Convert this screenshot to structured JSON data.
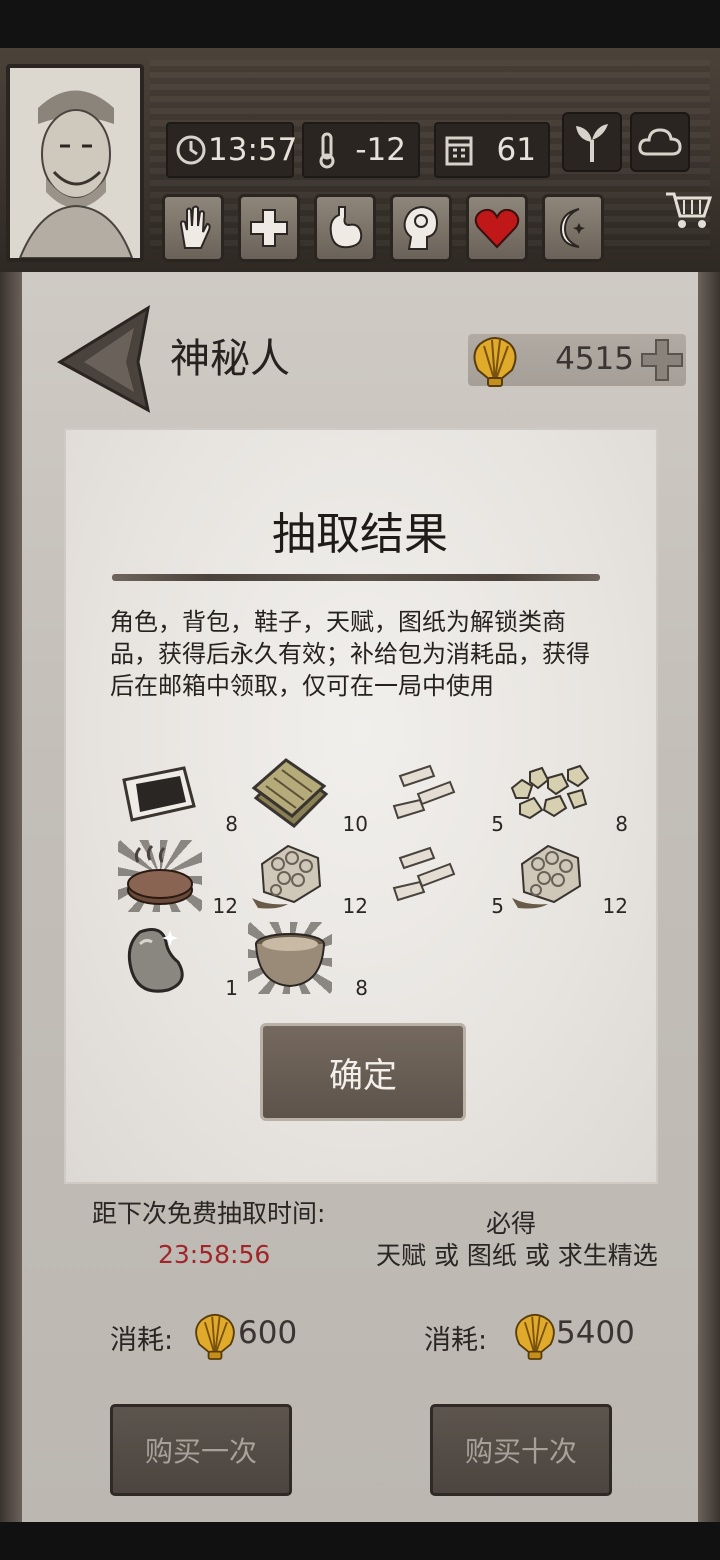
{
  "hud": {
    "time": "13:57",
    "temperature": "-12",
    "day": "61",
    "icons": {
      "clock": "clock-icon",
      "thermometer": "thermometer-icon",
      "calendar": "calendar-icon",
      "sprout": "sprout-icon",
      "weather": "cloud-icon",
      "cart": "shopping-cart-icon"
    },
    "status_icons": [
      "hand-icon",
      "medical-cross-icon",
      "stomach-icon",
      "head-icon",
      "heart-icon",
      "moon-icon"
    ]
  },
  "page": {
    "title": "神秘人",
    "currency_amount": "4515"
  },
  "modal": {
    "title": "抽取结果",
    "description": "角色，背包，鞋子，天赋，图纸为解锁类商品，获得后永久有效；补给包为消耗品，获得后在邮箱中领取，仅可在一局中使用",
    "items": [
      {
        "icon": "cloth-patch-icon",
        "count": "8"
      },
      {
        "icon": "wooden-boards-icon",
        "count": "10"
      },
      {
        "icon": "sticks-icon",
        "count": "5"
      },
      {
        "icon": "ore-nuggets-icon",
        "count": "8"
      },
      {
        "icon": "grilled-meat-icon",
        "count": "12"
      },
      {
        "icon": "honeycomb-icon",
        "count": "12"
      },
      {
        "icon": "sticks-icon",
        "count": "5"
      },
      {
        "icon": "honeycomb-icon",
        "count": "12"
      },
      {
        "icon": "bean-icon",
        "count": "1"
      },
      {
        "icon": "soup-bowl-icon",
        "count": "8"
      }
    ],
    "confirm_label": "确定"
  },
  "draw": {
    "timer_label": "距下次免费抽取时间:",
    "timer_value": "23:58:56",
    "guarantee_title": "必得",
    "guarantee_text": "天赋 或 图纸 或 求生精选",
    "cost_label": "消耗:",
    "cost_single": "600",
    "cost_ten": "5400",
    "buy_once_label": "购买一次",
    "buy_ten_label": "购买十次"
  },
  "colors": {
    "timer": "#a2252a",
    "paper": "#c3beb8",
    "modal": "#e9e6e2",
    "button": "#5d534a"
  }
}
